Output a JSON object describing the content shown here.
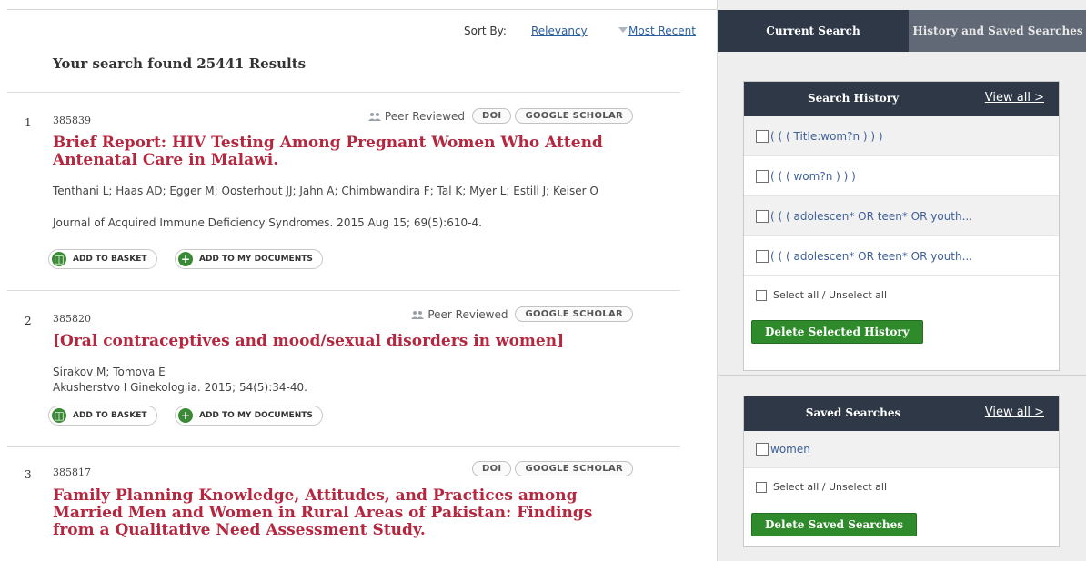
{
  "sort": {
    "label": "Sort By:",
    "relevancy": "Relevancy",
    "recent": "Most Recent"
  },
  "results_summary": "Your search found 25441 Results",
  "records": [
    {
      "num": "1",
      "id": "385839",
      "peer": "Peer Reviewed",
      "doi": "DOI",
      "scholar": "GOOGLE SCHOLAR",
      "title": "Brief Report: HIV Testing Among Pregnant Women Who Attend Antenatal Care in Malawi.",
      "authors": "Tenthani L; Haas AD; Egger M; Oosterhout JJ; Jahn A; Chimbwandira F; Tal K; Myer L; Estill J; Keiser O",
      "journal": "Journal of Acquired Immune Deficiency Syndromes. 2015 Aug 15; 69(5):610-4.",
      "basket": "ADD TO BASKET",
      "mydocs": "ADD TO MY DOCUMENTS"
    },
    {
      "num": "2",
      "id": "385820",
      "peer": "Peer Reviewed",
      "scholar": "GOOGLE SCHOLAR",
      "title": "[Oral contraceptives and mood/sexual disorders in women]",
      "authors": "Sirakov M; Tomova E",
      "journal": "Akusherstvo I Ginekologiia. 2015; 54(5):34-40.",
      "basket": "ADD TO BASKET",
      "mydocs": "ADD TO MY DOCUMENTS"
    },
    {
      "num": "3",
      "id": "385817",
      "doi": "DOI",
      "scholar": "GOOGLE SCHOLAR",
      "title": "Family Planning Knowledge, Attitudes, and Practices among Married Men and Women in Rural Areas of Pakistan: Findings from a Qualitative Need Assessment Study."
    }
  ],
  "panel": {
    "tab_current": "Current Search",
    "tab_history": "History and Saved Searches",
    "history": {
      "title": "Search History",
      "view_all": "View all >",
      "items": [
        "( ( ( Title:wom?n ) ) )",
        "( ( ( wom?n ) ) )",
        "( ( ( adolescen* OR teen* OR youth...",
        "( ( ( adolescen* OR teen* OR youth..."
      ],
      "select_all": "Select all / Unselect all",
      "delete": "Delete Selected History"
    },
    "saved": {
      "title": "Saved Searches",
      "view_all": "View all >",
      "items": [
        "women"
      ],
      "select_all": "Select all / Unselect all",
      "delete": "Delete Saved Searches"
    }
  },
  "colors": {
    "title_red": "#b5263f",
    "link_blue": "#2a5d9f",
    "navy": "#2f3847",
    "green": "#2f8a2b"
  }
}
